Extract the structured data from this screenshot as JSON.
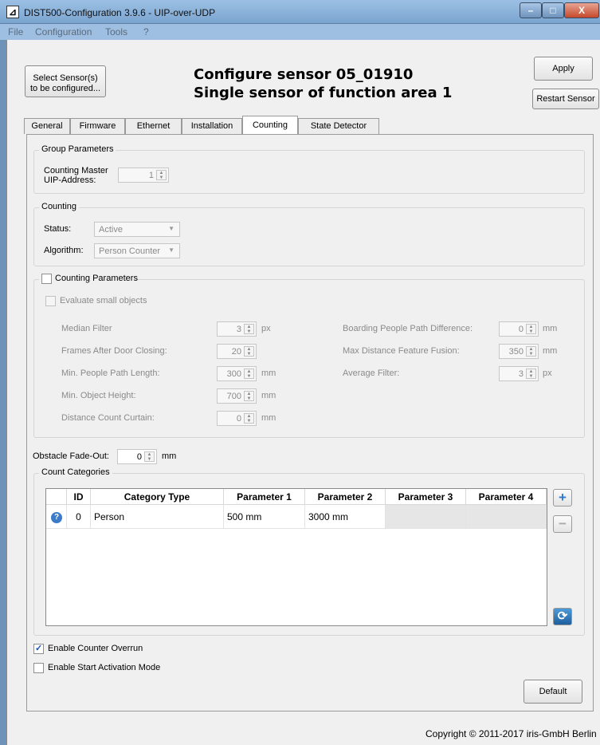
{
  "window": {
    "title": "DIST500-Configuration 3.9.6  -  UIP-over-UDP",
    "icon_name": "app-icon"
  },
  "menu": [
    "File",
    "Configuration",
    "Tools",
    "?"
  ],
  "header": {
    "select_sensor_label_1": "Select Sensor(s)",
    "select_sensor_label_2": "to be configured...",
    "title_line1": "Configure sensor 05_01910",
    "title_line2": "Single sensor of function area 1",
    "apply_label": "Apply",
    "restart_label": "Restart Sensor"
  },
  "tabs": [
    "General",
    "Firmware",
    "Ethernet",
    "Installation",
    "Counting",
    "State Detector"
  ],
  "active_tab": "Counting",
  "group_params": {
    "title": "Group Parameters",
    "master_label_1": "Counting Master",
    "master_label_2": "UIP-Address:",
    "master_value": "1"
  },
  "counting": {
    "title": "Counting",
    "status_label": "Status:",
    "status_value": "Active",
    "algorithm_label": "Algorithm:",
    "algorithm_value": "Person Counter"
  },
  "counting_params": {
    "title": "Counting Parameters",
    "evaluate_small": "Evaluate small objects",
    "median_filter": {
      "label": "Median Filter",
      "value": "3",
      "unit": "px"
    },
    "frames_after": {
      "label": "Frames After Door Closing:",
      "value": "20",
      "unit": ""
    },
    "min_path": {
      "label": "Min. People Path Length:",
      "value": "300",
      "unit": "mm"
    },
    "min_height": {
      "label": "Min. Object Height:",
      "value": "700",
      "unit": "mm"
    },
    "distance_curtain": {
      "label": "Distance Count Curtain:",
      "value": "0",
      "unit": "mm"
    },
    "boarding_diff": {
      "label": "Boarding People Path Difference:",
      "value": "0",
      "unit": "mm"
    },
    "max_distance": {
      "label": "Max Distance Feature Fusion:",
      "value": "350",
      "unit": "mm"
    },
    "average_filter": {
      "label": "Average Filter:",
      "value": "3",
      "unit": "px"
    }
  },
  "obstacle": {
    "label": "Obstacle Fade-Out:",
    "value": "0",
    "unit": "mm"
  },
  "count_categories": {
    "title": "Count Categories",
    "columns": [
      "ID",
      "Category Type",
      "Parameter 1",
      "Parameter 2",
      "Parameter 3",
      "Parameter 4"
    ],
    "rows": [
      {
        "id": "0",
        "type": "Person",
        "p1": "500 mm",
        "p2": "3000 mm",
        "p3": "",
        "p4": ""
      }
    ]
  },
  "options": {
    "counter_overrun": "Enable Counter Overrun",
    "start_activation": "Enable Start Activation Mode"
  },
  "default_label": "Default",
  "copyright": "Copyright © 2011-2017 iris-GmbH Berlin"
}
